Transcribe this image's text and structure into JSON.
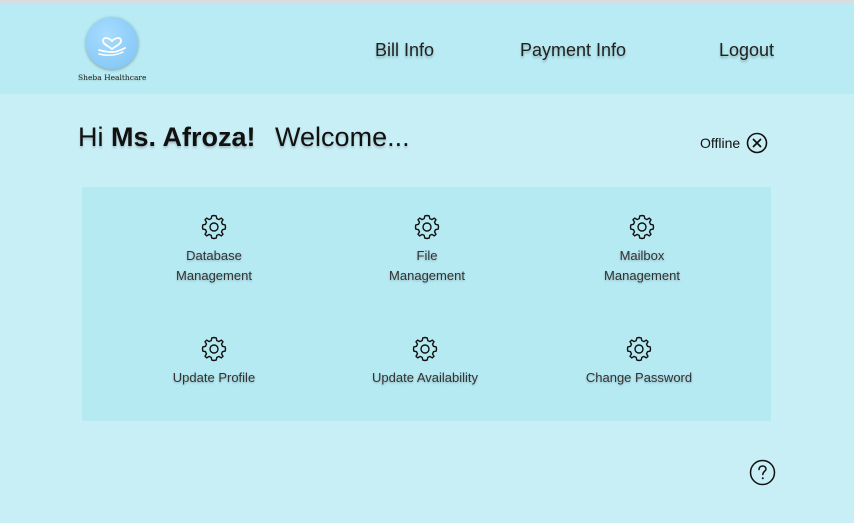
{
  "header": {
    "logo_text": "Sheba Healthcare",
    "nav": [
      {
        "label": "Bill Info"
      },
      {
        "label": "Payment Info"
      },
      {
        "label": "Logout"
      }
    ]
  },
  "greeting": {
    "hi": "Hi",
    "name": "Ms. Afroza!",
    "welcome": "Welcome..."
  },
  "status": {
    "label": "Offline",
    "icon": "close-circle-icon"
  },
  "tiles": [
    {
      "line1": "Database",
      "line2": "Management",
      "icon": "gear-icon"
    },
    {
      "line1": "File",
      "line2": "Management",
      "icon": "gear-icon"
    },
    {
      "line1": "Mailbox",
      "line2": "Management",
      "icon": "gear-icon"
    },
    {
      "line1": "Update Profile",
      "line2": "",
      "icon": "gear-icon"
    },
    {
      "line1": "Update Availability",
      "line2": "",
      "icon": "gear-icon"
    },
    {
      "line1": "Change Password",
      "line2": "",
      "icon": "gear-icon"
    }
  ],
  "help": {
    "icon": "question-circle-icon"
  },
  "colors": {
    "page_bg": "#c9eff6",
    "header_bg": "#b8ebf3",
    "panel_bg": "#b6eaf3",
    "logo": "#7cc3f4"
  }
}
